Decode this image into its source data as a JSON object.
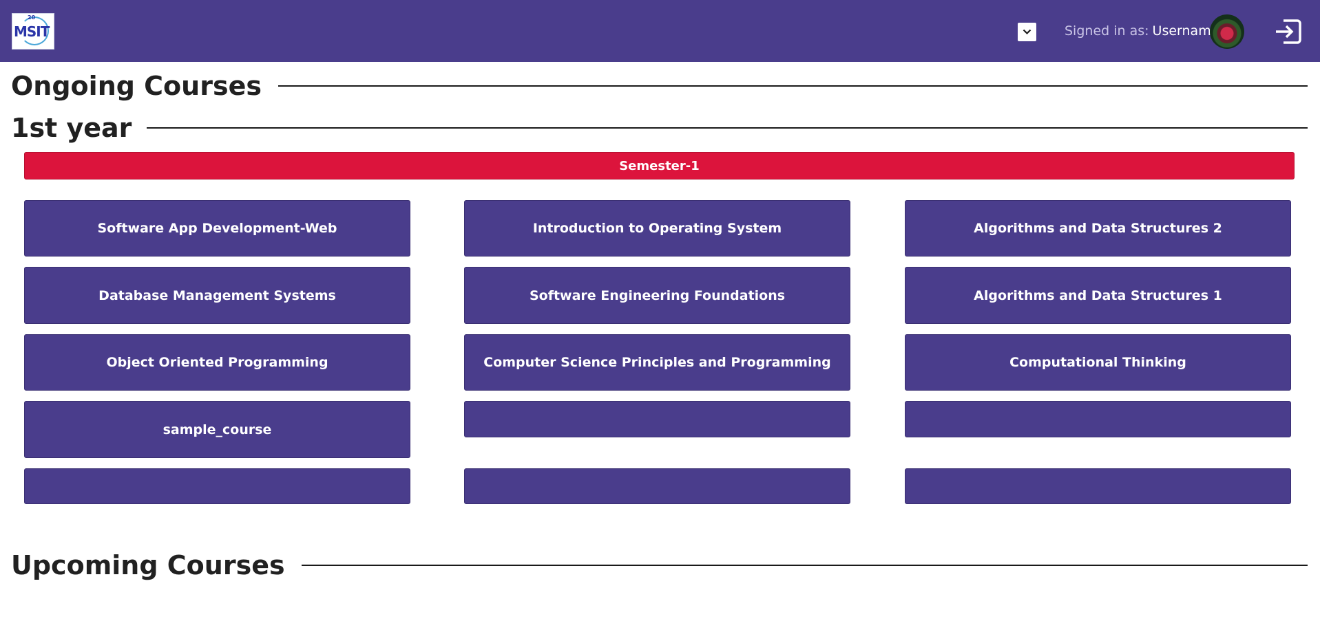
{
  "header": {
    "logo_text": "MSIT",
    "logo_number": "20",
    "signed_in_label": "Signed in as:",
    "username": "Username"
  },
  "sections": {
    "ongoing_title": "Ongoing Courses",
    "year_title": "1st year",
    "semester_label": "Semester-1",
    "upcoming_title": "Upcoming Courses"
  },
  "courses": [
    "Software App Development-Web",
    "Introduction to Operating System",
    "Algorithms and Data Structures 2",
    "Database Management Systems",
    "Software Engineering Foundations",
    "Algorithms and Data Structures 1",
    "Object Oriented Programming",
    "Computer Science Principles and Programming",
    "Computational Thinking",
    "sample_course",
    "",
    "",
    "",
    "",
    ""
  ],
  "colors": {
    "navbar": "#4a3d8c",
    "card": "#4a3d8c",
    "semester": "#dc143c"
  },
  "icons": {
    "dropdown": "chevron-down-icon",
    "logout": "logout-icon"
  }
}
